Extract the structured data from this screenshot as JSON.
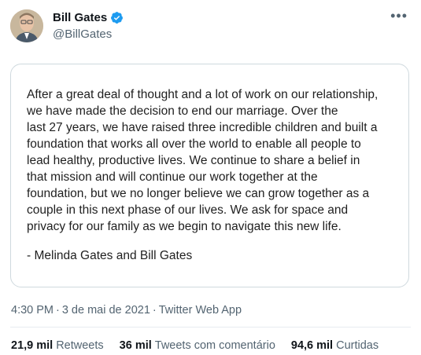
{
  "author": {
    "name": "Bill Gates",
    "handle": "@BillGates",
    "verified_color": "#1d9bf0"
  },
  "tweet": {
    "statement": "After a great deal of thought and a lot of work on our relationship,\nwe have made the decision to end our marriage. Over the\nlast 27 years, we have raised three incredible children and built a\nfoundation that works all over the world to enable all people to\nlead healthy, productive lives. We continue to share a belief in\nthat mission and will continue our work together at the\nfoundation, but we no longer believe we can grow together as a\ncouple in this next phase of our lives. We ask for space and\nprivacy for our family as we begin to navigate this new life.",
    "signature": "- Melinda Gates and Bill Gates",
    "time": "4:30 PM",
    "date": "3 de mai de 2021",
    "source": "Twitter Web App"
  },
  "stats": {
    "retweets_count": "21,9 mil",
    "retweets_label": "Retweets",
    "quotes_count": "36 mil",
    "quotes_label": "Tweets com comentário",
    "likes_count": "94,6 mil",
    "likes_label": "Curtidas"
  },
  "icons": {
    "more": "more-icon",
    "verified": "verified-badge-icon"
  }
}
